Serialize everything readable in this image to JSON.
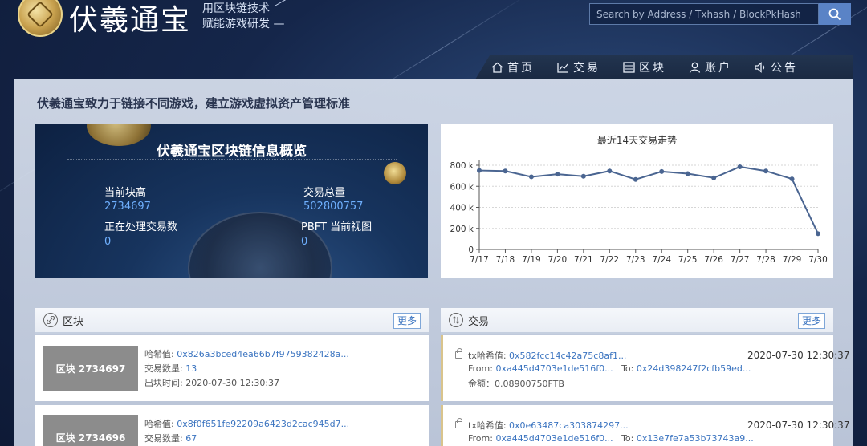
{
  "header": {
    "logo_title": "伏羲通宝",
    "slogan_line1": "用区块链技术",
    "slogan_line2": "赋能游戏研发 —",
    "search_placeholder": "Search by Address / Txhash / BlockPkHash"
  },
  "nav": {
    "items": [
      {
        "label": "首页",
        "icon": "home-icon"
      },
      {
        "label": "交易",
        "icon": "chart-icon"
      },
      {
        "label": "区块",
        "icon": "list-icon"
      },
      {
        "label": "账户",
        "icon": "user-icon"
      },
      {
        "label": "公告",
        "icon": "speaker-icon"
      }
    ]
  },
  "tagline": "伏羲通宝致力于链接不同游戏，建立游戏虚拟资产管理标准",
  "overview": {
    "title": "伏羲通宝区块链信息概览",
    "current_height_label": "当前块高",
    "current_height_value": "2734697",
    "tx_total_label": "交易总量",
    "tx_total_value": "502800757",
    "processing_label": "正在处理交易数",
    "processing_value": "0",
    "pbft_label": "PBFT 当前视图",
    "pbft_value": "0"
  },
  "chart_data": {
    "type": "line",
    "title": "最近14天交易走势",
    "categories": [
      "7/17",
      "7/18",
      "7/19",
      "7/20",
      "7/21",
      "7/22",
      "7/23",
      "7/24",
      "7/25",
      "7/26",
      "7/27",
      "7/28",
      "7/29",
      "7/30"
    ],
    "values": [
      750000,
      745000,
      690000,
      715000,
      695000,
      745000,
      665000,
      740000,
      720000,
      680000,
      785000,
      745000,
      670000,
      150000
    ],
    "y_ticks": [
      0,
      200000,
      400000,
      600000,
      800000
    ],
    "y_tick_labels": [
      "0",
      "200 k",
      "400 k",
      "600 k",
      "800 k"
    ],
    "ylim": [
      0,
      800000
    ],
    "line_color": "#4a6591",
    "grid": "dotted"
  },
  "blocks": {
    "title": "区块",
    "more": "更多",
    "items": [
      {
        "label": "区块 2734697",
        "hash_key": "哈希值:",
        "hash": "0x826a3bced4ea66b7f9759382428a...",
        "count_key": "交易数量:",
        "count": "13",
        "time_key": "出块时间:",
        "time": "2020-07-30 12:30:37"
      },
      {
        "label": "区块 2734696",
        "hash_key": "哈希值:",
        "hash": "0x8f0f651fe92209a6423d2cac945d7...",
        "count_key": "交易数量:",
        "count": "67"
      }
    ]
  },
  "transactions": {
    "title": "交易",
    "more": "更多",
    "items": [
      {
        "hash_key": "tx哈希值:",
        "hash": "0x582fcc14c42a75c8af1...",
        "time": "2020-07-30 12:30:37",
        "from_key": "From:",
        "from": "0xa445d4703e1de516f0...",
        "to_key": "To:",
        "to": "0x24d398247f2cfb59ed...",
        "amount_key": "金额：",
        "amount": "0.08900750FTB"
      },
      {
        "hash_key": "tx哈希值:",
        "hash": "0x0e63487ca303874297...",
        "time": "2020-07-30 12:30:37",
        "from_key": "From:",
        "from": "0xa445d4703e1de516f0...",
        "to_key": "To:",
        "to": "0x13e7fe7a53b73743a9..."
      }
    ]
  },
  "colors": {
    "accent": "#3b74c0",
    "overview_value": "#6fb0ff",
    "search_button": "#5a83c6"
  }
}
